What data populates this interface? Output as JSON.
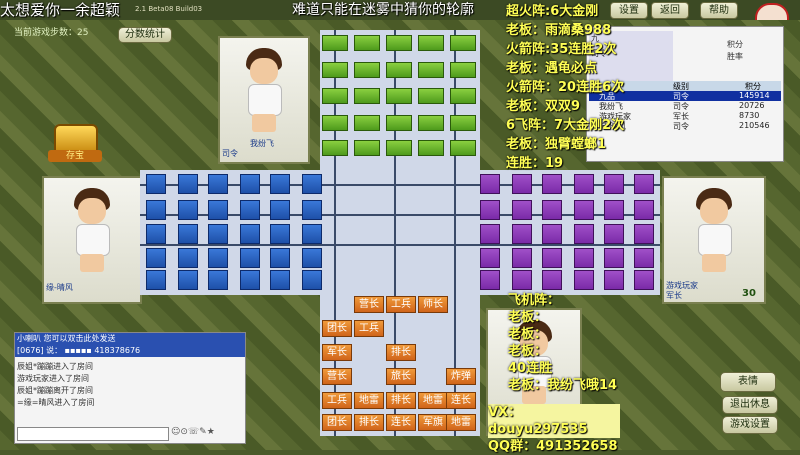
{
  "title_bar": {
    "user_tag": "太想爱你一余超颖",
    "version": "2.1 Beta08 Build03",
    "marquee": "难道只能在迷雾中猜你的轮廓",
    "btn_settings": "设置",
    "btn_return": "返回",
    "btn_help": "帮助"
  },
  "info": {
    "step_label": "当前游戏步数：",
    "step_value": "25",
    "score_button": "分数统计",
    "treasure_label": "存宝"
  },
  "players": {
    "north": {
      "name": "我纷飞",
      "rank": "司令"
    },
    "west": {
      "name": "缘-晴风"
    },
    "east": {
      "name": "游戏玩家",
      "rank": "军长",
      "count": "30"
    },
    "south": {}
  },
  "player_list": {
    "top_row": {
      "name": "九",
      "rank": "司令"
    },
    "label_row": [
      "积分",
      "胜率"
    ],
    "headers": [
      "级别",
      "积分"
    ],
    "rows": [
      {
        "name": "九品",
        "rank": "司令",
        "score": "145914"
      },
      {
        "name": "我纷飞",
        "rank": "司令",
        "score": "20726"
      },
      {
        "name": "游戏玩家",
        "rank": "军长",
        "score": "8730"
      },
      {
        "name": "缘-晴风",
        "rank": "司令",
        "score": "210546"
      }
    ]
  },
  "overlay_right": [
    "超火阵:6大金刚",
    "老板：雨滴桑988",
    "火箭阵:35连胜2次",
    "老板：遇龟必点",
    "火箭阵：20连胜6次",
    "老板：双双9",
    "6飞阵：7大金刚2次",
    "老板：独臂螳螂1",
    "连胜：19"
  ],
  "overlay_bottom": [
    "飞机阵：",
    "老板：",
    "老板：",
    "老板：",
    "40连胜",
    "老板：我纷飞哦14"
  ],
  "contact": {
    "vx": "VX：douyu297535",
    "qq": "QQ群：491352658"
  },
  "chat": {
    "placeholder_line": "小喇叭 您可以双击此处发送",
    "msg_line": "[0676] 说：  ▪▪▪▪▪ 418378676",
    "messages": [
      "辰姐*蹦蹦进入了房间",
      "游戏玩家进入了房间",
      "辰姐*蹦蹦离开了房间",
      "=缘=晴风进入了房间"
    ]
  },
  "buttons": {
    "emote": "表情",
    "waiting": "退出休息",
    "settings2": "游戏设置"
  },
  "south_pieces": [
    [
      "营长",
      "工兵",
      "师长"
    ],
    [
      "团长",
      "工兵"
    ],
    [
      "军长",
      "排长"
    ],
    [
      "营长",
      "旅长",
      "炸弹"
    ],
    [
      "工兵",
      "地雷",
      "排长",
      "地雷",
      "连长"
    ],
    [
      "团长",
      "排长",
      "连长",
      "军旗",
      "地雷"
    ]
  ],
  "colors": {
    "blue": "#2a5fc0",
    "purple": "#8a36b8",
    "green": "#6ab82e",
    "orange": "#e07a24",
    "overlay_yellow": "#ffff55"
  }
}
